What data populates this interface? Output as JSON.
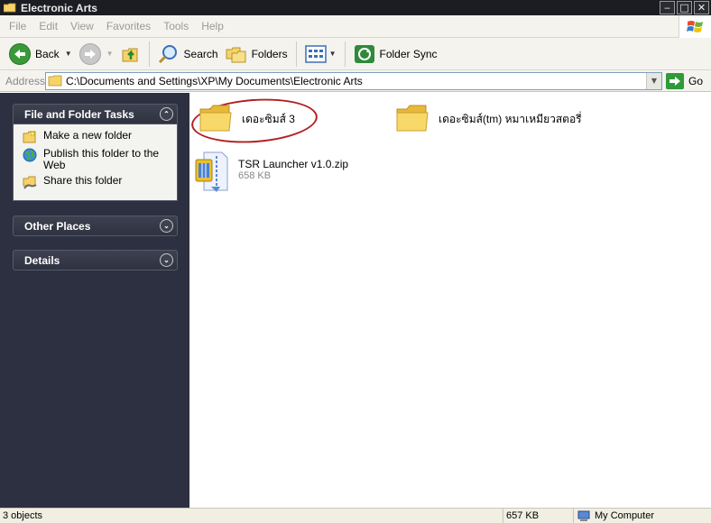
{
  "window": {
    "title": "Electronic Arts",
    "icon": "folder-icon",
    "buttons": [
      "minimize",
      "maximize",
      "close"
    ]
  },
  "menu": [
    "File",
    "Edit",
    "View",
    "Favorites",
    "Tools",
    "Help"
  ],
  "toolbar": {
    "back_label": "Back",
    "search_label": "Search",
    "folders_label": "Folders",
    "sync_label": "Folder Sync"
  },
  "address": {
    "label": "Address",
    "value": "C:\\Documents and Settings\\XP\\My Documents\\Electronic Arts",
    "go_label": "Go"
  },
  "taskpane": {
    "file_tasks": {
      "title": "File and Folder Tasks",
      "items": [
        "Make a new folder",
        "Publish this folder to the Web",
        "Share this folder"
      ]
    },
    "other_places": {
      "title": "Other Places"
    },
    "details": {
      "title": "Details"
    }
  },
  "files": [
    {
      "name": "เดอะซิมส์ 3",
      "type": "folder"
    },
    {
      "name": "เดอะซิมส์(tm) หมาเหมียวสตอรี่",
      "type": "folder"
    },
    {
      "name": "TSR Launcher v1.0.zip",
      "type": "zip",
      "size": "658 KB"
    }
  ],
  "status": {
    "objects": "3 objects",
    "size": "657 KB",
    "location": "My Computer"
  },
  "colors": {
    "title_bar": "#1b1d22",
    "task_pane": "#2d3040",
    "highlight": "#b32020"
  }
}
